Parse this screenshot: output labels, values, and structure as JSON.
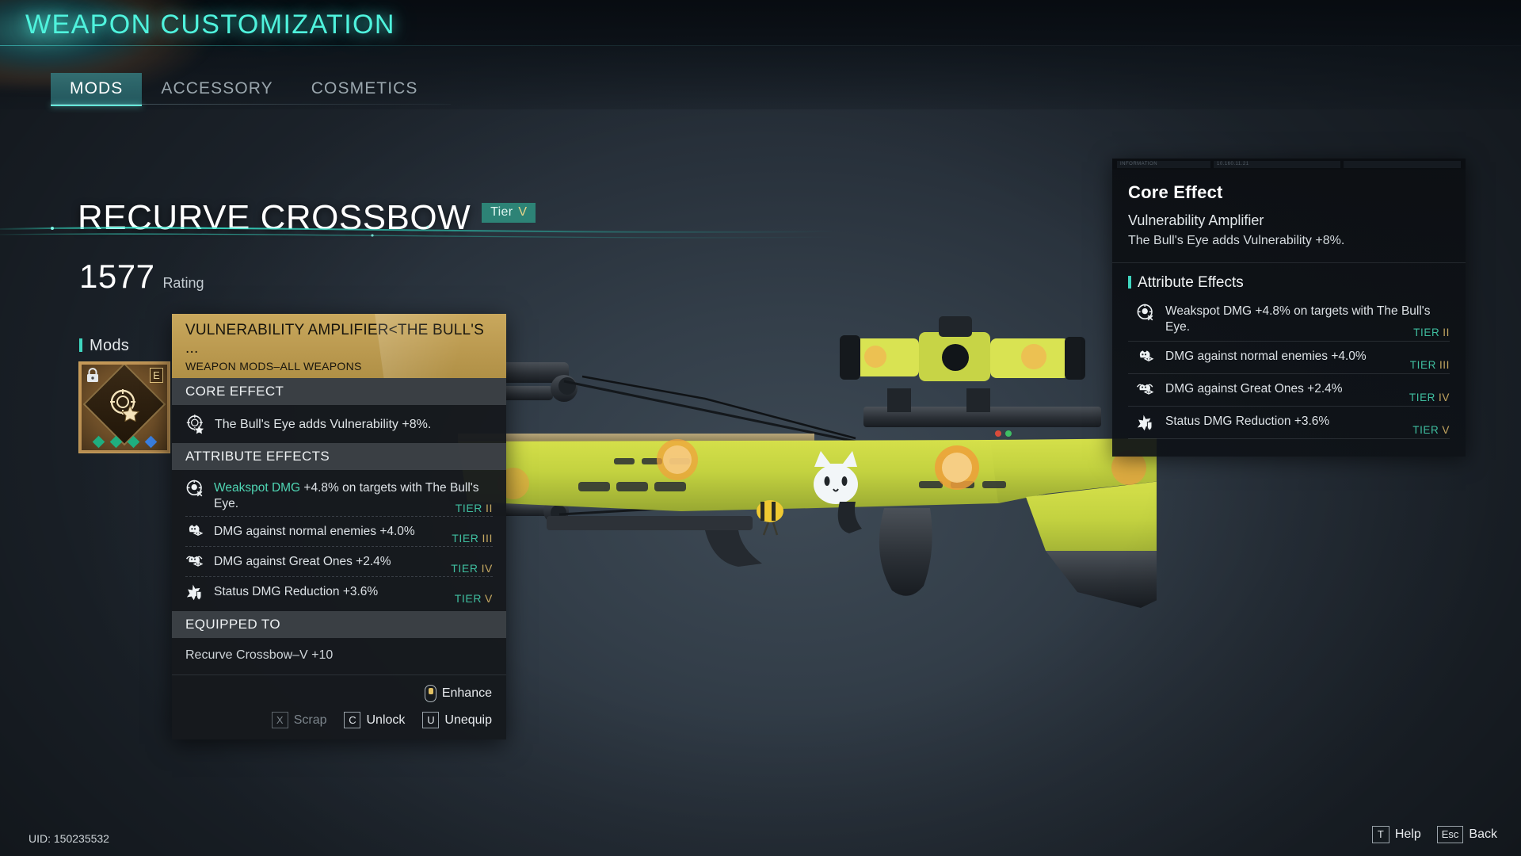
{
  "header": {
    "title": "WEAPON CUSTOMIZATION",
    "tabs": [
      {
        "label": "MODS",
        "active": true
      },
      {
        "label": "ACCESSORY",
        "active": false
      },
      {
        "label": "COSMETICS",
        "active": false
      }
    ]
  },
  "weapon": {
    "name": "RECURVE CROSSBOW",
    "tier_label": "Tier",
    "tier_value": "V",
    "rating_value": "1577",
    "rating_label": "Rating"
  },
  "mods": {
    "section_label": "Mods",
    "slot": {
      "rarity_letter": "E",
      "lock_icon": "lock-icon",
      "glyph_icon": "bullseye-star-icon",
      "gems": [
        "#1fae7f",
        "#1fae7f",
        "#1fae7f",
        "#3a7fe0"
      ]
    }
  },
  "tooltip": {
    "title": "VULNERABILITY AMPLIFIER<THE BULL'S ...",
    "subtitle": "WEAPON MODS–ALL WEAPONS",
    "core_section_label": "CORE EFFECT",
    "core_icon": "bullseye-star-icon",
    "core_text": "The Bull's Eye adds Vulnerability +8%.",
    "attr_section_label": "ATTRIBUTE EFFECTS",
    "attributes": [
      {
        "icon": "weakspot-target-icon",
        "gem": "#1fae7f",
        "highlight": "Weakspot DMG",
        "text": " +4.8% on targets with The Bull's Eye.",
        "tier_label": "TIER",
        "tier_value": "II"
      },
      {
        "icon": "normal-enemy-icon",
        "gem": "#1fae7f",
        "highlight": "",
        "text": "DMG against normal enemies +4.0%",
        "tier_label": "TIER",
        "tier_value": "III"
      },
      {
        "icon": "great-one-icon",
        "gem": "#1fae7f",
        "highlight": "",
        "text": "DMG against Great Ones +2.4%",
        "tier_label": "TIER",
        "tier_value": "IV"
      },
      {
        "icon": "status-shield-icon",
        "gem": "#3a7fe0",
        "highlight": "",
        "text": "Status DMG Reduction +3.6%",
        "tier_label": "TIER",
        "tier_value": "V"
      }
    ],
    "equipped_section_label": "EQUIPPED TO",
    "equipped_value": "Recurve Crossbow–V +10",
    "actions": {
      "enhance": {
        "key_icon": "mouse-left-click-icon",
        "label": "Enhance",
        "enabled": true
      },
      "scrap": {
        "key": "X",
        "label": "Scrap",
        "enabled": false
      },
      "unlock": {
        "key": "C",
        "label": "Unlock",
        "enabled": true
      },
      "unequip": {
        "key": "U",
        "label": "Unequip",
        "enabled": true
      }
    }
  },
  "info_panel": {
    "chrome": {
      "left_label": "INFORMATION",
      "mid_label": "10.160.11.21",
      "right_label": ""
    },
    "core_title": "Core Effect",
    "core_name": "Vulnerability Amplifier",
    "core_desc": "The Bull's Eye adds Vulnerability +8%.",
    "attr_title": "Attribute Effects",
    "attributes": [
      {
        "icon": "weakspot-target-icon",
        "gem": "#1fae7f",
        "text": "Weakspot DMG +4.8% on targets with The Bull's Eye.",
        "tier_label": "TIER",
        "tier_value": "II"
      },
      {
        "icon": "normal-enemy-icon",
        "gem": "#1fae7f",
        "text": "DMG against normal enemies +4.0%",
        "tier_label": "TIER",
        "tier_value": "III"
      },
      {
        "icon": "great-one-icon",
        "gem": "#1fae7f",
        "text": "DMG against Great Ones +2.4%",
        "tier_label": "TIER",
        "tier_value": "IV"
      },
      {
        "icon": "status-shield-icon",
        "gem": "#3a7fe0",
        "text": "Status DMG Reduction +3.6%",
        "tier_label": "TIER",
        "tier_value": "V"
      }
    ]
  },
  "footer": {
    "uid": "UID: 150235532",
    "actions": [
      {
        "key": "T",
        "label": "Help"
      },
      {
        "key": "Esc",
        "label": "Back"
      }
    ]
  },
  "colors": {
    "accent_teal": "#4ff3dd",
    "tier_gold": "#c6a861",
    "rarity_gold": "#c9a85d",
    "gem_green": "#1fae7f",
    "gem_blue": "#3a7fe0"
  }
}
